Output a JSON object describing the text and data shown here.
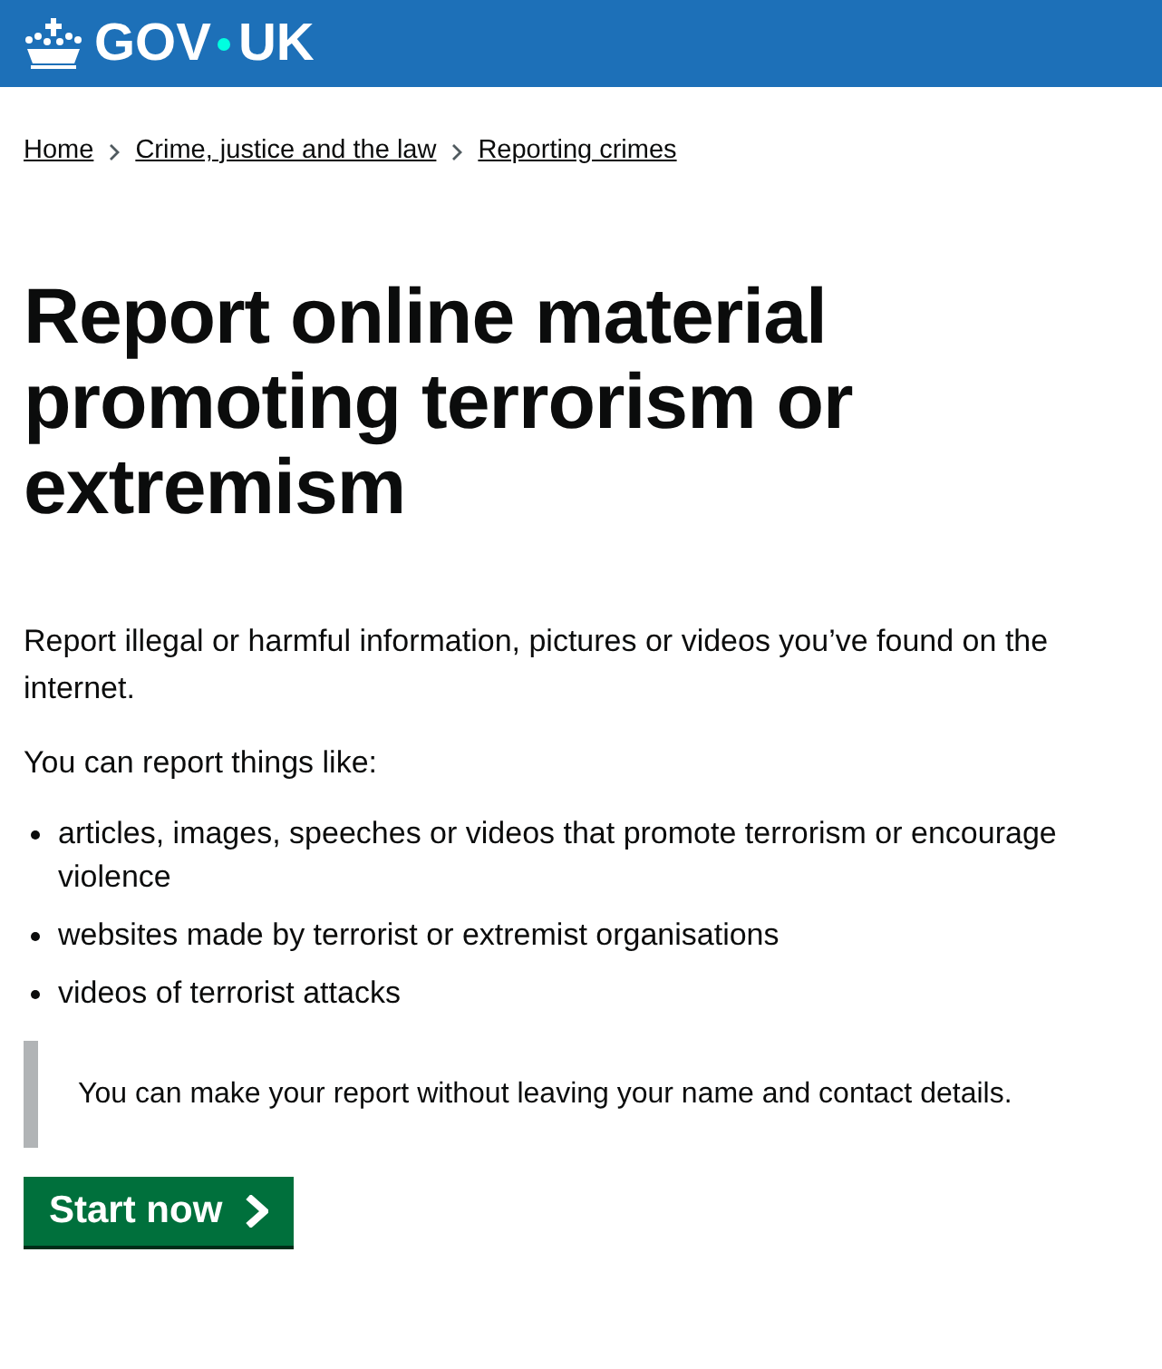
{
  "header": {
    "logo": {
      "left": "GOV",
      "right": "UK"
    }
  },
  "breadcrumbs": [
    "Home",
    "Crime, justice and the law",
    "Reporting crimes"
  ],
  "title": "Report online material promoting terrorism or extremism",
  "intro": "Report illegal or harmful information, pictures or videos you’ve found on the internet.",
  "list_lead": "You can report things like:",
  "list": [
    "articles, images, speeches or videos that promote terrorism or encourage violence",
    "websites made by terrorist or extremist organisations",
    "videos of terrorist attacks"
  ],
  "inset": "You can make your report without leaving your name and contact details.",
  "start_button": "Start now"
}
